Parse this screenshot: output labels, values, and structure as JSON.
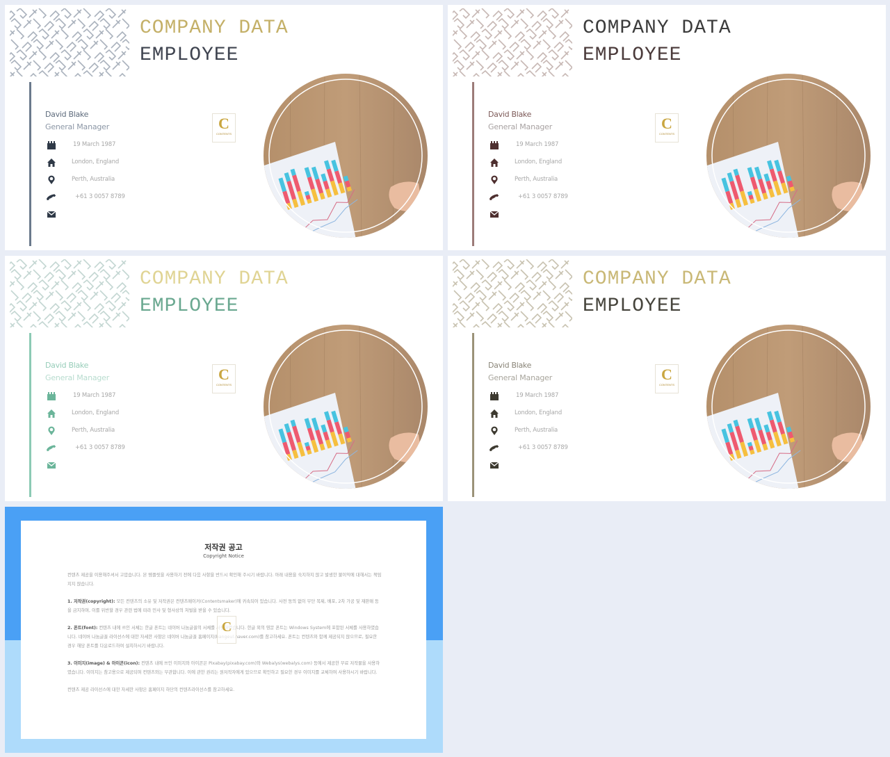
{
  "slides": [
    {
      "theme": "slate",
      "colors": {
        "title1": "#c4b068",
        "title2": "#3f4450",
        "accent": "#6b7a8c",
        "icon": "#2f3947",
        "name": "#5e6b7c",
        "role": "#8c97a6",
        "pattern": "#aab2bd"
      },
      "title_line1": "COMPANY DATA",
      "title_line2": "EMPLOYEE",
      "name": "David Blake",
      "role": "General Manager",
      "info": [
        {
          "icon": "calendar-icon",
          "text": "19 March 1987"
        },
        {
          "icon": "home-icon",
          "text": "London, England"
        },
        {
          "icon": "location-pin-icon",
          "text": "Perth, Australia"
        },
        {
          "icon": "phone-icon",
          "text": "+61 3 0057 8789"
        },
        {
          "icon": "envelope-icon",
          "text": ""
        }
      ],
      "logo": {
        "letter": "C",
        "caption": "CONTENTS"
      }
    },
    {
      "theme": "mauve",
      "colors": {
        "title1": "#3c3c3c",
        "title2": "#4a3a3a",
        "accent": "#9c7b78",
        "icon": "#4e2f2f",
        "name": "#7d5a58",
        "role": "#a8a2a2",
        "pattern": "#c7b8b4"
      },
      "title_line1": "COMPANY DATA",
      "title_line2": "EMPLOYEE",
      "name": "David Blake",
      "role": "General Manager",
      "info": [
        {
          "icon": "calendar-icon",
          "text": "19 March 1987"
        },
        {
          "icon": "home-icon",
          "text": "London, England"
        },
        {
          "icon": "location-pin-icon",
          "text": "Perth, Australia"
        },
        {
          "icon": "phone-icon",
          "text": "+61 3 0057 8789"
        },
        {
          "icon": "envelope-icon",
          "text": ""
        }
      ],
      "logo": {
        "letter": "C",
        "caption": "CONTENTS"
      }
    },
    {
      "theme": "mint",
      "colors": {
        "title1": "#e0d494",
        "title2": "#6aa890",
        "accent": "#8ccab4",
        "icon": "#6bb59a",
        "name": "#97cdb9",
        "role": "#b8dccf",
        "pattern": "#c3d6d2"
      },
      "title_line1": "COMPANY DATA",
      "title_line2": "EMPLOYEE",
      "name": "David Blake",
      "role": "General Manager",
      "info": [
        {
          "icon": "calendar-icon",
          "text": "19 March 1987"
        },
        {
          "icon": "home-icon",
          "text": "London, England"
        },
        {
          "icon": "location-pin-icon",
          "text": "Perth, Australia"
        },
        {
          "icon": "phone-icon",
          "text": "+61 3 0057 8789"
        },
        {
          "icon": "envelope-icon",
          "text": ""
        }
      ],
      "logo": {
        "letter": "C",
        "caption": "CONTENTS"
      }
    },
    {
      "theme": "olive",
      "colors": {
        "title1": "#c9b876",
        "title2": "#46443c",
        "accent": "#9b9278",
        "icon": "#3d3a30",
        "name": "#8a8578",
        "role": "#a8a59c",
        "pattern": "#c8c2b0"
      },
      "title_line1": "COMPANY DATA",
      "title_line2": "EMPLOYEE",
      "name": "David Blake",
      "role": "General Manager",
      "info": [
        {
          "icon": "calendar-icon",
          "text": "19 March 1987"
        },
        {
          "icon": "home-icon",
          "text": "London, England"
        },
        {
          "icon": "location-pin-icon",
          "text": "Perth, Australia"
        },
        {
          "icon": "phone-icon",
          "text": "+61 3 0057 8789"
        },
        {
          "icon": "envelope-icon",
          "text": ""
        }
      ],
      "logo": {
        "letter": "C",
        "caption": "CONTENTS"
      }
    }
  ],
  "copyright": {
    "title": "저작권 공고",
    "subtitle": "Copyright Notice",
    "intro": "컨텐츠 제공을 이용해주셔서 고맙습니다. 본 템플릿을 사용하기 전에 다음 사항을 반드시 확인해 주시기 바랍니다. 아래 내용을 숙지하지 않고 발생한 불이익에 대해서는 책임지지 않습니다.",
    "sections": [
      {
        "label": "1. 저작권(copyright):",
        "text": " 모든 컨텐츠의 소유 및 저작권은 컨텐츠메이커(Contentsmaker)에 귀속되어 있습니다. 사전 동의 없이 무단 복제, 배포, 2차 가공 및 재판매 등을 금지하며, 이를 위반할 경우 관련 법에 따라 민사 및 형사상의 처벌을 받을 수 있습니다."
      },
      {
        "label": "2. 폰트(font):",
        "text": " 컨텐츠 내에 쓰인 서체는 한글 폰트는 네이버 나눔글꼴의 서체를 사용하였습니다. 한글 외의 영문 폰트는 Windows System에 포함된 서체를 사용하였습니다. 네이버 나눔글꼴 라이선스에 대한 자세한 사항은 네이버 나눔글꼴 홈페이지(hangeul.naver.com)를 참고하세요. 폰트는 컨텐츠와 함께 제공되지 않으므로, 필요한 경우 해당 폰트를 다운로드하여 설치하시기 바랍니다."
      },
      {
        "label": "3. 이미지(image) & 아이콘(icon):",
        "text": " 컨텐츠 내에 쓰인 이미지와 아이콘은 Pixabay(pixabay.com)와 Webalys(webalys.com) 등에서 제공한 무료 저작물을 사용하였습니다. 이미지는 참고용으로 제공되며 컨텐츠와는 무관합니다. 이에 관한 권리는 원저작자에게 있으므로 확인하고 필요한 경우 이미지를 교체하여 사용하시기 바랍니다."
      }
    ],
    "footer": "컨텐츠 제공 라이선스에 대한 자세한 사항은 홈페이지 하단의 컨텐츠라이선스를 참고하세요.",
    "colors": {
      "band_top": "#4aa0f5",
      "band_bottom": "#aedbfb"
    },
    "logo_letter": "C"
  }
}
